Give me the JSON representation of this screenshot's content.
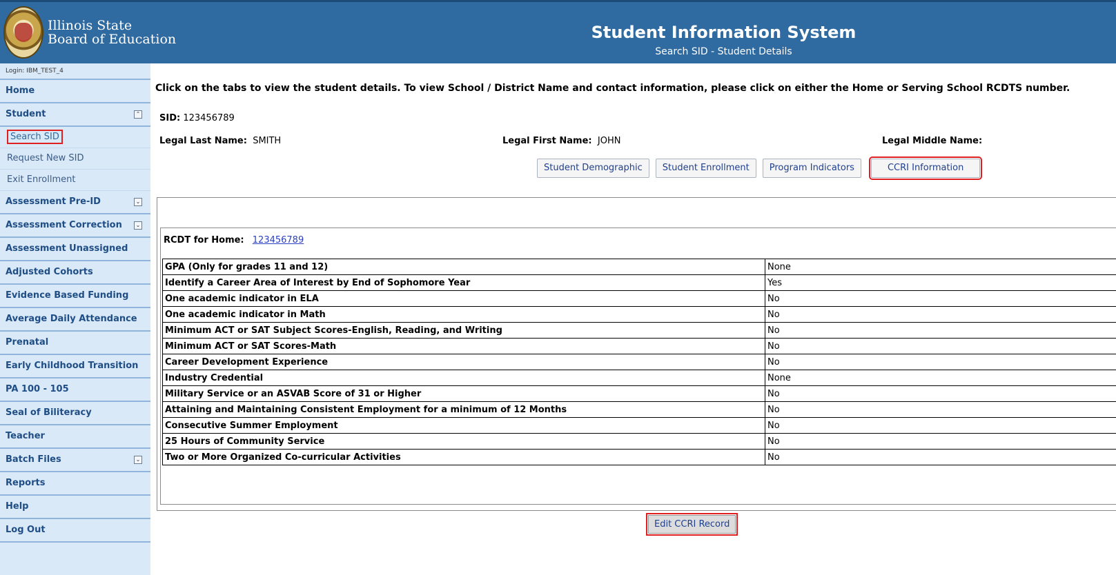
{
  "header": {
    "org_line1": "Illinois State",
    "org_line2": "Board of Education",
    "app_title": "Student Information System",
    "page_subtitle": "Search SID - Student Details"
  },
  "sidebar": {
    "login": "Login: IBM_TEST_4",
    "items": [
      {
        "label": "Home"
      },
      {
        "label": "Student"
      },
      {
        "label": "Search SID"
      },
      {
        "label": "Request New SID"
      },
      {
        "label": "Exit Enrollment"
      },
      {
        "label": "Assessment Pre-ID"
      },
      {
        "label": "Assessment Correction"
      },
      {
        "label": "Assessment Unassigned"
      },
      {
        "label": "Adjusted Cohorts"
      },
      {
        "label": "Evidence Based Funding"
      },
      {
        "label": "Average Daily Attendance"
      },
      {
        "label": "Prenatal"
      },
      {
        "label": "Early Childhood Transition"
      },
      {
        "label": "PA 100 - 105"
      },
      {
        "label": "Seal of Biliteracy"
      },
      {
        "label": "Teacher"
      },
      {
        "label": "Batch Files"
      },
      {
        "label": "Reports"
      },
      {
        "label": "Help"
      },
      {
        "label": "Log Out"
      }
    ]
  },
  "main": {
    "instructions": "Click on the tabs to view the student details. To view School / District Name and contact information, please click on either the Home or Serving School RCDTS number.",
    "sid_label": "SID:",
    "sid_value": "123456789",
    "last_name_label": "Legal Last Name:",
    "last_name_value": "SMITH",
    "first_name_label": "Legal First Name:",
    "first_name_value": "JOHN",
    "middle_name_label": "Legal Middle Name:",
    "tabs": [
      {
        "label": "Student Demographic"
      },
      {
        "label": "Student Enrollment"
      },
      {
        "label": "Program Indicators"
      },
      {
        "label": "CCRI Information"
      }
    ],
    "rcdt_label": "RCDT for Home:",
    "rcdt_value": "123456789",
    "rows": [
      {
        "k": "GPA (Only for grades 11 and 12)",
        "v": "None"
      },
      {
        "k": "Identify a Career Area of Interest by End of Sophomore Year",
        "v": "Yes"
      },
      {
        "k": "One academic indicator in ELA",
        "v": "No"
      },
      {
        "k": "One academic indicator in Math",
        "v": "No"
      },
      {
        "k": "Minimum ACT or SAT Subject Scores-English, Reading, and Writing",
        "v": "No"
      },
      {
        "k": "Minimum ACT or SAT Scores-Math",
        "v": "No"
      },
      {
        "k": "Career Development Experience",
        "v": "No"
      },
      {
        "k": "Industry Credential",
        "v": "None"
      },
      {
        "k": "Military Service or an ASVAB Score of 31 or Higher",
        "v": "No"
      },
      {
        "k": "Attaining and Maintaining Consistent Employment for a minimum of 12 Months",
        "v": "No"
      },
      {
        "k": "Consecutive Summer Employment",
        "v": "No"
      },
      {
        "k": "25 Hours of Community Service",
        "v": "No"
      },
      {
        "k": "Two or More Organized Co-curricular Activities",
        "v": "No"
      }
    ],
    "edit_button": "Edit CCRI Record"
  }
}
